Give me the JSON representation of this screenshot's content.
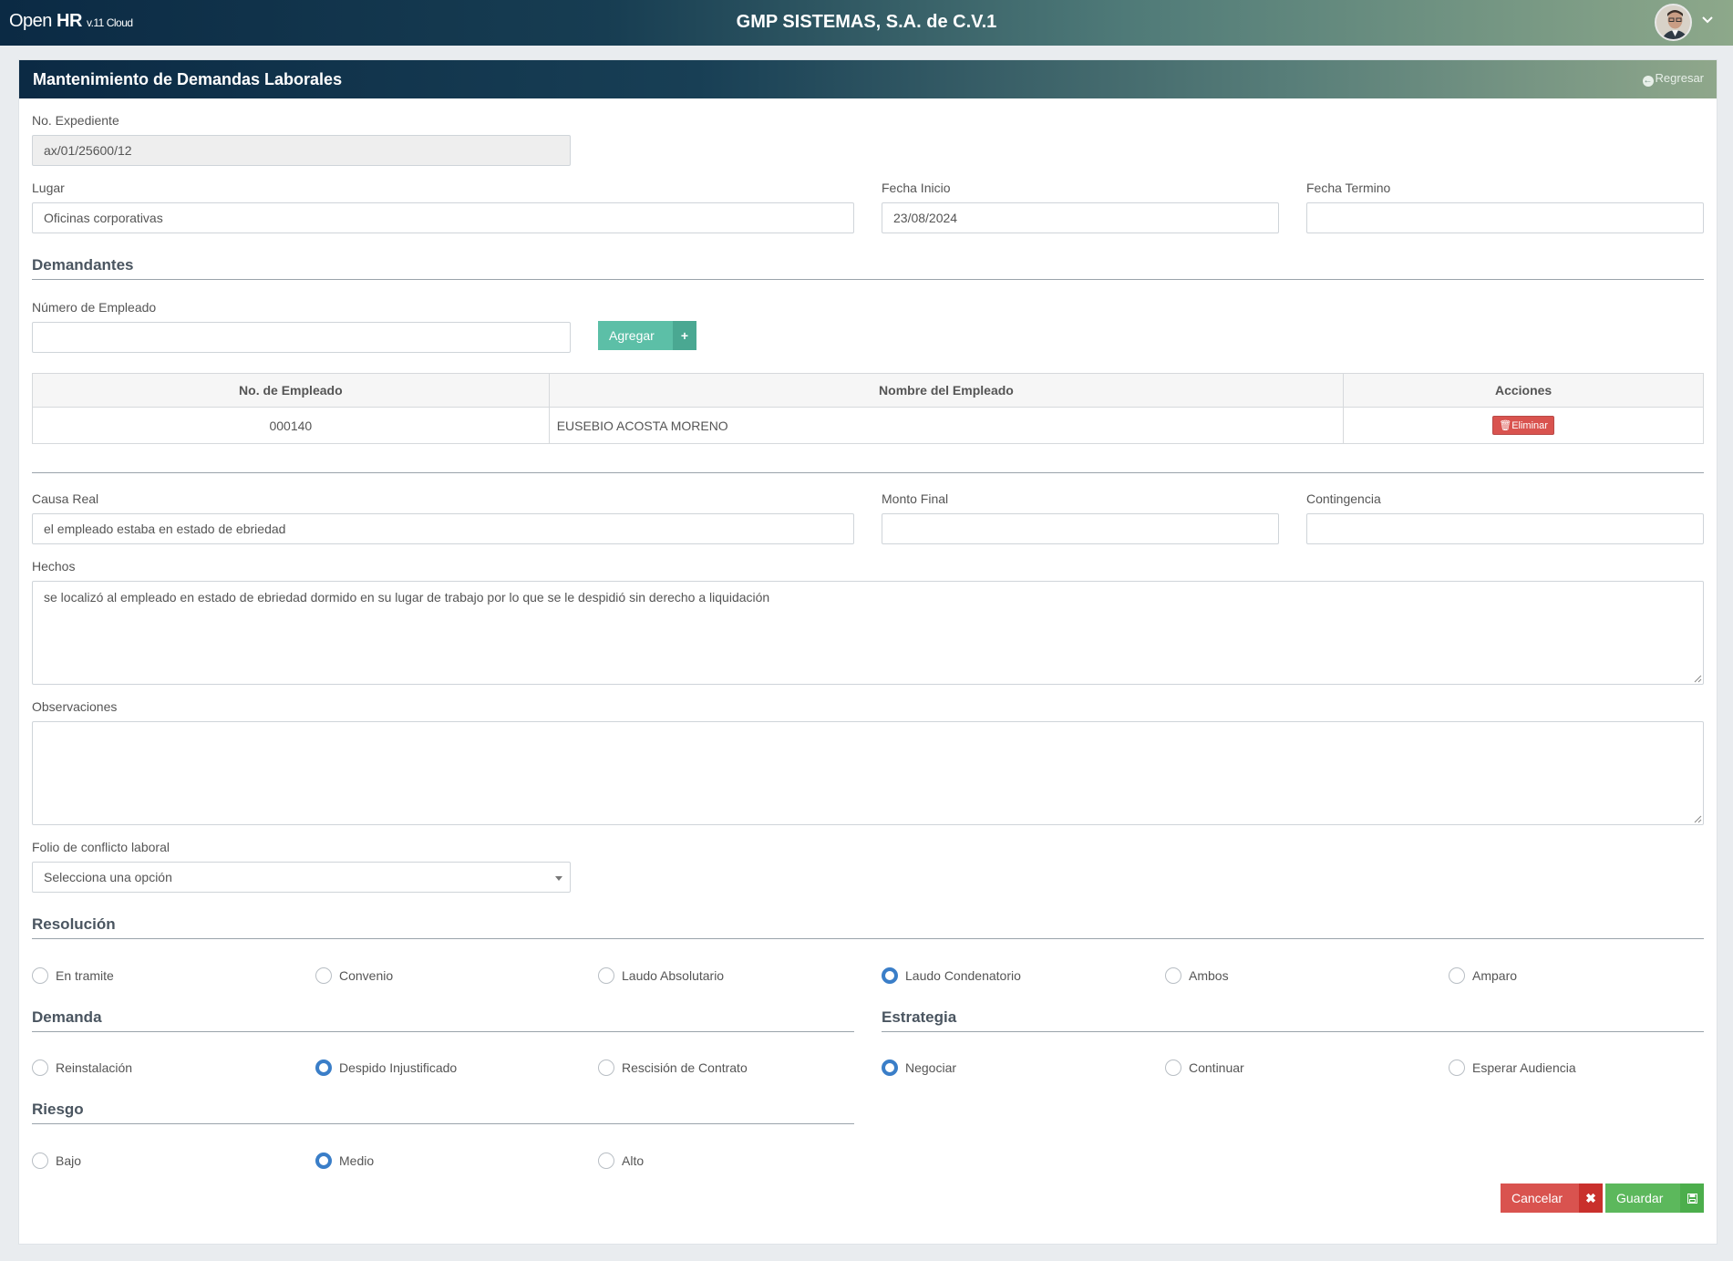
{
  "topbar": {
    "brand_open": "Open",
    "brand_hr": "HR",
    "brand_version": "v.11 Cloud",
    "company": "GMP SISTEMAS, S.A. de C.V.1",
    "avatar_icon": "user-avatar",
    "caret_icon": "chevron-down-icon"
  },
  "panel": {
    "title": "Mantenimiento de Demandas Laborales",
    "back_label": "Regresar"
  },
  "form": {
    "expediente_label": "No. Expediente",
    "expediente_value": "ax/01/25600/12",
    "lugar_label": "Lugar",
    "lugar_value": "Oficinas corporativas",
    "fecha_inicio_label": "Fecha Inicio",
    "fecha_inicio_value": "23/08/2024",
    "fecha_termino_label": "Fecha Termino",
    "fecha_termino_value": "",
    "demandantes_title": "Demandantes",
    "num_empleado_label": "Número de Empleado",
    "num_empleado_value": "",
    "agregar_label": "Agregar",
    "causa_label": "Causa Real",
    "causa_value": "el empleado estaba en estado de ebriedad",
    "monto_label": "Monto Final",
    "monto_value": "",
    "contingencia_label": "Contingencia",
    "contingencia_value": "",
    "hechos_label": "Hechos",
    "hechos_value": "se localizó al empleado en estado de ebriedad dormido en su lugar de trabajo por lo que se le despidió sin derecho a liquidación",
    "observaciones_label": "Observaciones",
    "observaciones_value": "",
    "folio_label": "Folio de conflicto laboral",
    "folio_value": "Selecciona una opción"
  },
  "table": {
    "headers": [
      "No. de Empleado",
      "Nombre del Empleado",
      "Acciones"
    ],
    "rows": [
      {
        "numero": "000140",
        "nombre": "EUSEBIO ACOSTA MORENO",
        "accion": "Eliminar"
      }
    ]
  },
  "resolucion": {
    "title": "Resolución",
    "options": [
      "En tramite",
      "Convenio",
      "Laudo Absolutario",
      "Laudo Condenatorio",
      "Ambos",
      "Amparo"
    ],
    "selected": "Laudo Condenatorio"
  },
  "demanda": {
    "title": "Demanda",
    "options": [
      "Reinstalación",
      "Despido Injustificado",
      "Rescisión de Contrato"
    ],
    "selected": "Despido Injustificado"
  },
  "estrategia": {
    "title": "Estrategia",
    "options": [
      "Negociar",
      "Continuar",
      "Esperar Audiencia"
    ],
    "selected": "Negociar"
  },
  "riesgo": {
    "title": "Riesgo",
    "options": [
      "Bajo",
      "Medio",
      "Alto"
    ],
    "selected": "Medio"
  },
  "actions": {
    "cancel_label": "Cancelar",
    "save_label": "Guardar"
  },
  "colors": {
    "accent_teal": "#5cbfa7",
    "danger": "#d9534f",
    "success": "#5cb85c",
    "radio_selected": "#3a7ec8"
  }
}
